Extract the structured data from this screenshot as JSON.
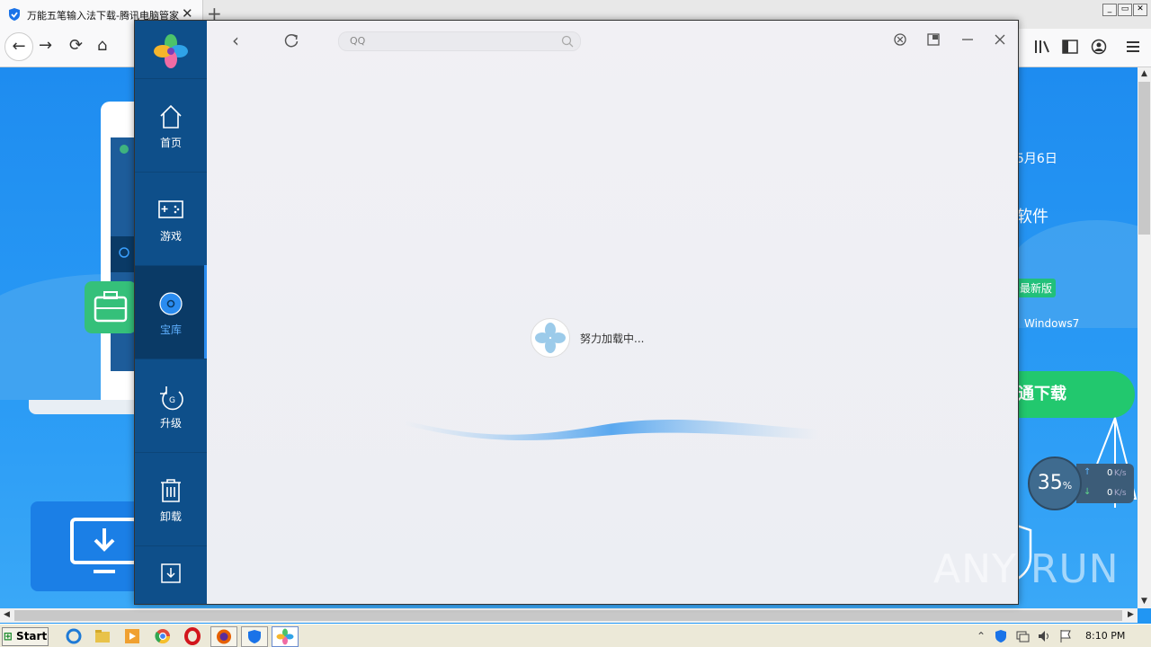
{
  "browser": {
    "tab_title": "万能五笔输入法下载-腾讯电脑管家",
    "tab_close": "✕",
    "new_tab": "+",
    "nav_back": "←",
    "nav_forward": "→",
    "nav_reload": "⟳",
    "nav_home": "⌂",
    "window_buttons": [
      "_",
      "▭",
      "✕"
    ]
  },
  "background_page": {
    "date_fragment": "5月6日",
    "software_fragment": "软件",
    "new_version_tag": "最新版",
    "os_text": "Windows7",
    "download_button": "通下载"
  },
  "speed_widget": {
    "percent": "35",
    "percent_unit": "%",
    "upload_value": "0",
    "upload_unit": "K/s",
    "download_value": "0",
    "download_unit": "K/s"
  },
  "app": {
    "sidebar_items": [
      {
        "label": "首页",
        "icon": "home-icon"
      },
      {
        "label": "游戏",
        "icon": "gamepad-icon"
      },
      {
        "label": "宝库",
        "icon": "disc-icon",
        "active": true
      },
      {
        "label": "升级",
        "icon": "upgrade-icon"
      },
      {
        "label": "卸载",
        "icon": "trash-icon"
      }
    ],
    "search": {
      "value": "QQ",
      "placeholder": "QQ"
    },
    "loading_text": "努力加载中..."
  },
  "watermark": "ANY RUN",
  "taskbar": {
    "start_label": "Start",
    "clock": "8:10 PM"
  },
  "colors": {
    "sidebar": "#0e4f8a",
    "sidebar_active": "#0a3a66",
    "accent_green": "#22c86e",
    "page_blue": "#2196f3"
  }
}
